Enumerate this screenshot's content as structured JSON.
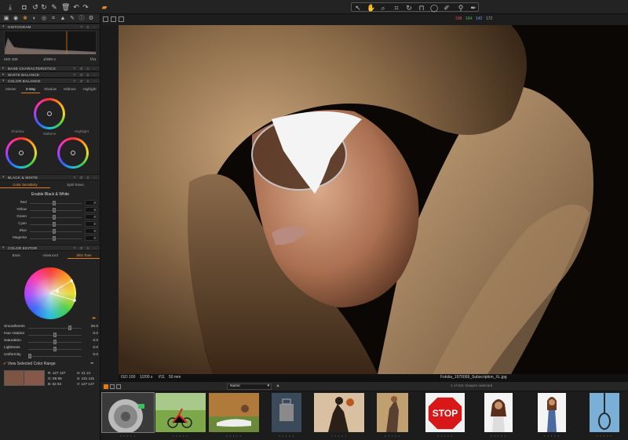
{
  "toolbar": {
    "left_icons": [
      "import-icon",
      "camera-icon",
      "rotate-left-icon",
      "rotate-right-icon",
      "trash-icon",
      "undo-icon",
      "redo-icon",
      "variants-icon"
    ],
    "cursor_tools": [
      "pointer-icon",
      "hand-icon",
      "zoom-icon",
      "crop-icon",
      "rotate-icon",
      "keystone-icon",
      "spot-icon",
      "brush-icon",
      "eraser-icon",
      "picker-icon"
    ]
  },
  "left_tabs": [
    "library-icon",
    "capture-icon",
    "color-icon",
    "exposure-icon",
    "lens-icon",
    "crop-icon",
    "details-icon",
    "adjust-icon",
    "metadata-icon",
    "output-icon"
  ],
  "sections": {
    "histogram": "HISTOGRAM",
    "base": "BASE CHARACTERISTICS",
    "wb": "WHITE BALANCE",
    "cb": "COLOR BALANCE",
    "bw": "BLACK & WHITE",
    "ce": "COLOR EDITOR"
  },
  "histogram_info": {
    "iso": "ISO 100",
    "shutter": "1/200 s",
    "aperture": "f/11"
  },
  "color_balance": {
    "tabs": [
      "Master",
      "3-Way",
      "Shadow",
      "Midtone",
      "Highlight"
    ],
    "active_tab": "3-Way",
    "labels": {
      "shadow": "Shadow",
      "midtone": "Midtone",
      "highlight": "Highlight"
    }
  },
  "black_white": {
    "tabs": [
      "Color Sensitivity",
      "Split Tones"
    ],
    "enable_label": "Enable Black & White",
    "sliders": [
      {
        "label": "Red",
        "value": "0"
      },
      {
        "label": "Yellow",
        "value": "0"
      },
      {
        "label": "Green",
        "value": "0"
      },
      {
        "label": "Cyan",
        "value": "0"
      },
      {
        "label": "Blue",
        "value": "0"
      },
      {
        "label": "Magenta",
        "value": "0"
      }
    ]
  },
  "color_editor": {
    "tabs": [
      "Basic",
      "Advanced",
      "Skin Tone"
    ],
    "active_tab": "Skin Tone",
    "sliders": [
      {
        "label": "Smoothness",
        "value": "26.0",
        "level": 0.8
      },
      {
        "label": "Hue rotation",
        "value": "0.0",
        "level": 0.5
      },
      {
        "label": "Saturation",
        "value": "0.0",
        "level": 0.5
      },
      {
        "label": "Lightness",
        "value": "0.0",
        "level": 0.5
      },
      {
        "label": "Uniformity",
        "value": "0.0",
        "level": 0.0
      }
    ],
    "view_range_label": "View Selected Color Range",
    "readout": {
      "r_label": "R:",
      "r_vals": "127  127",
      "g_label": "G:",
      "g_vals": "86   85",
      "b_label": "B:",
      "b_vals": "62   62",
      "h_label": "H:",
      "h_vals": "21   21",
      "s_label": "S:",
      "s_vals": "131  131",
      "v_label": "V:",
      "v_vals": "127  127"
    }
  },
  "viewer": {
    "rgb_r": "198",
    "rgb_g": "164",
    "rgb_b": "142",
    "rgb_l": "172",
    "colors": {
      "r": "#e05050",
      "g": "#50c050",
      "b": "#6aa0ff",
      "l": "#aaaaaa"
    },
    "meta": {
      "iso": "ISO 100",
      "shutter": "1/200 s",
      "aperture": "f/11",
      "focal": "50 mm",
      "filename": "Fotolia_1970069_Subscription_XL.jpg"
    }
  },
  "browser": {
    "sort_value": "Name",
    "count_text": "1 of 611 Images selected",
    "thumb_stars": "• • • • •",
    "thumbnails": [
      "camera-dial",
      "cyclist",
      "woman-lying",
      "fashion-bag",
      "basketball-silhouette",
      "woman-leaning",
      "stop-sign",
      "woman-portrait",
      "woman-standing",
      "noose"
    ],
    "stop_text": "STOP"
  },
  "accent": "#e07a1a"
}
